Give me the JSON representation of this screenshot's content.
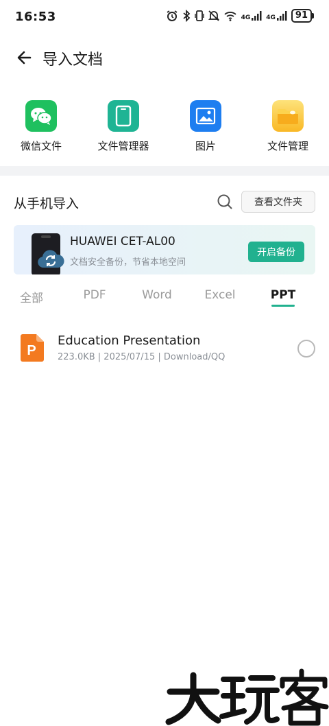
{
  "status_bar": {
    "time": "16:53",
    "battery": "91",
    "net1": "4G",
    "net2": "4G",
    "icons": [
      "alarm-icon",
      "bluetooth-icon",
      "vibrate-icon",
      "mute-icon",
      "wifi-icon",
      "signal-icon",
      "signal-icon",
      "battery-icon"
    ]
  },
  "header": {
    "title": "导入文档"
  },
  "quick_sources": [
    {
      "label": "微信文件",
      "icon": "wechat-icon",
      "color": "#1fc05f"
    },
    {
      "label": "文件管理器",
      "icon": "tablet-icon",
      "color": "#1fb494"
    },
    {
      "label": "图片",
      "icon": "picture-icon",
      "color": "#1e7ef0"
    },
    {
      "label": "文件管理",
      "icon": "folder-icon",
      "color": "#f9b825"
    }
  ],
  "section": {
    "title": "从手机导入",
    "folder_button": "查看文件夹"
  },
  "backup_card": {
    "device_name": "HUAWEI CET-AL00",
    "subtitle": "文档安全备份，节省本地空间",
    "button": "开启备份"
  },
  "tabs": [
    {
      "label": "全部",
      "active": false
    },
    {
      "label": "PDF",
      "active": false
    },
    {
      "label": "Word",
      "active": false
    },
    {
      "label": "Excel",
      "active": false
    },
    {
      "label": "PPT",
      "active": true
    }
  ],
  "files": [
    {
      "name": "Education Presentation",
      "meta": "223.0KB | 2025/07/15 | Download/QQ",
      "icon": "ppt-file-icon",
      "icon_letter": "P"
    }
  ],
  "watermark": "大玩客",
  "colors": {
    "accent": "#21b18f",
    "ppt": "#f37a20"
  }
}
